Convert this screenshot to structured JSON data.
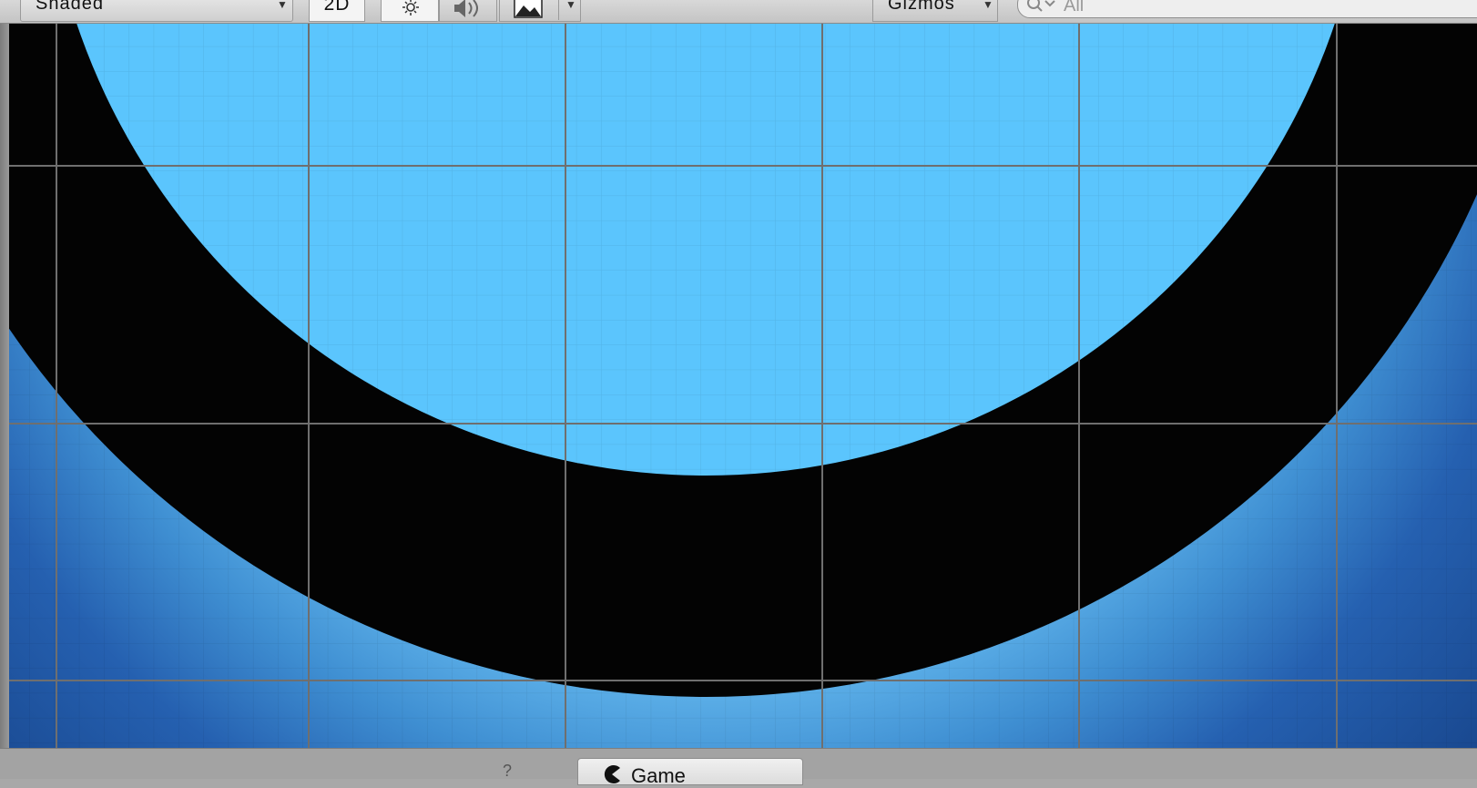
{
  "toolbar": {
    "shading_mode": "Shaded",
    "mode_2d_label": "2D",
    "gizmos_label": "Gizmos",
    "search_placeholder": "All"
  },
  "icons": {
    "shading_arrow": "dropdown-arrow-icon",
    "lighting": "sun-icon",
    "audio": "speaker-icon",
    "effects": "image-icon",
    "effects_arrow": "dropdown-arrow-icon",
    "gizmos_arrow": "dropdown-arrow-icon",
    "search": "search-icon",
    "game_tab": "pacman-icon"
  },
  "bottom": {
    "hint_text": "?",
    "game_tab_label": "Game"
  },
  "colors": {
    "disk_fill": "#5bc5fd",
    "ring_fill": "#030303",
    "background_center": "#8fd3ff",
    "background_edge": "#173f84",
    "grid_line": "#6f6f6f"
  }
}
